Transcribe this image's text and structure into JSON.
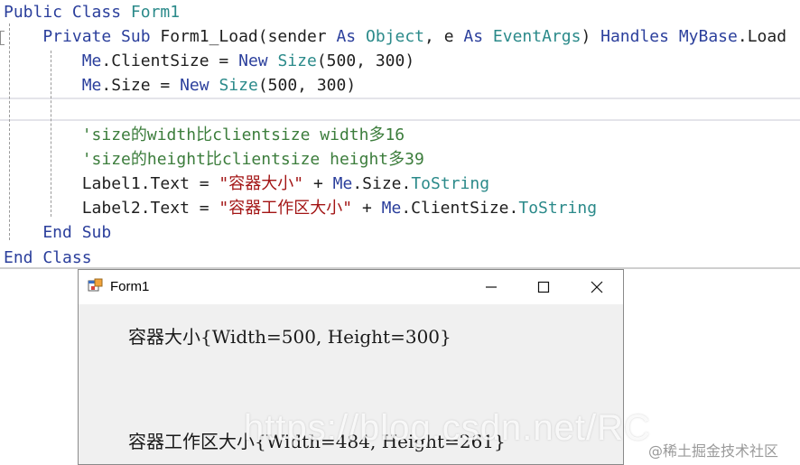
{
  "code_editor": {
    "lines": [
      {
        "tokens": [
          {
            "t": "Public Class ",
            "k": "kw"
          },
          {
            "t": "Form1",
            "k": "type"
          }
        ]
      },
      {
        "tokens": [
          {
            "t": "    Private Sub ",
            "k": "kw"
          },
          {
            "t": "Form1_Load(sender ",
            "k": "pl"
          },
          {
            "t": "As ",
            "k": "kw"
          },
          {
            "t": "Object",
            "k": "type"
          },
          {
            "t": ", e ",
            "k": "pl"
          },
          {
            "t": "As ",
            "k": "kw"
          },
          {
            "t": "EventArgs",
            "k": "type"
          },
          {
            "t": ") ",
            "k": "pl"
          },
          {
            "t": "Handles ",
            "k": "kw"
          },
          {
            "t": "MyBase",
            "k": "kw"
          },
          {
            "t": ".Load",
            "k": "pl"
          }
        ]
      },
      {
        "tokens": [
          {
            "t": "        ",
            "k": "pl"
          },
          {
            "t": "Me",
            "k": "kw"
          },
          {
            "t": ".ClientSize = ",
            "k": "pl"
          },
          {
            "t": "New ",
            "k": "kw"
          },
          {
            "t": "Size",
            "k": "type"
          },
          {
            "t": "(500, 300)",
            "k": "pl"
          }
        ]
      },
      {
        "tokens": [
          {
            "t": "        ",
            "k": "pl"
          },
          {
            "t": "Me",
            "k": "kw"
          },
          {
            "t": ".Size = ",
            "k": "pl"
          },
          {
            "t": "New ",
            "k": "kw"
          },
          {
            "t": "Size",
            "k": "type"
          },
          {
            "t": "(500, 300)",
            "k": "pl"
          }
        ]
      },
      {
        "tokens": [
          {
            "t": "",
            "k": "pl"
          }
        ]
      },
      {
        "tokens": [
          {
            "t": "        'size的width比clientsize width多16",
            "k": "cm"
          }
        ]
      },
      {
        "tokens": [
          {
            "t": "        'size的height比clientsize height多39",
            "k": "cm"
          }
        ]
      },
      {
        "tokens": [
          {
            "t": "        Label1.Text = ",
            "k": "pl"
          },
          {
            "t": "\"容器大小\"",
            "k": "str"
          },
          {
            "t": " + ",
            "k": "pl"
          },
          {
            "t": "Me",
            "k": "kw"
          },
          {
            "t": ".Size.",
            "k": "pl"
          },
          {
            "t": "ToString",
            "k": "type"
          }
        ]
      },
      {
        "tokens": [
          {
            "t": "        Label2.Text = ",
            "k": "pl"
          },
          {
            "t": "\"容器工作区大小\"",
            "k": "str"
          },
          {
            "t": " + ",
            "k": "pl"
          },
          {
            "t": "Me",
            "k": "kw"
          },
          {
            "t": ".ClientSize.",
            "k": "pl"
          },
          {
            "t": "ToString",
            "k": "type"
          }
        ]
      },
      {
        "tokens": [
          {
            "t": "    End Sub",
            "k": "kw"
          }
        ]
      },
      {
        "tokens": [
          {
            "t": "End Class",
            "k": "kw"
          }
        ]
      }
    ]
  },
  "form_window": {
    "title": "Form1",
    "label1": "容器大小{Width=500, Height=300}",
    "label2": "容器工作区大小{Width=484, Height=261}",
    "icons": {
      "app": "form-app-icon",
      "minimize": "minimize-icon",
      "maximize": "maximize-icon",
      "close": "close-icon"
    }
  },
  "watermarks": {
    "url": "https://blog.csdn.net/RC",
    "site": "@稀土掘金技术社区"
  },
  "colors": {
    "keyword": "#2b3f9c",
    "type": "#2b8a8a",
    "string": "#a31515",
    "comment": "#3c7d3c",
    "form_background": "#f0f0f0"
  }
}
